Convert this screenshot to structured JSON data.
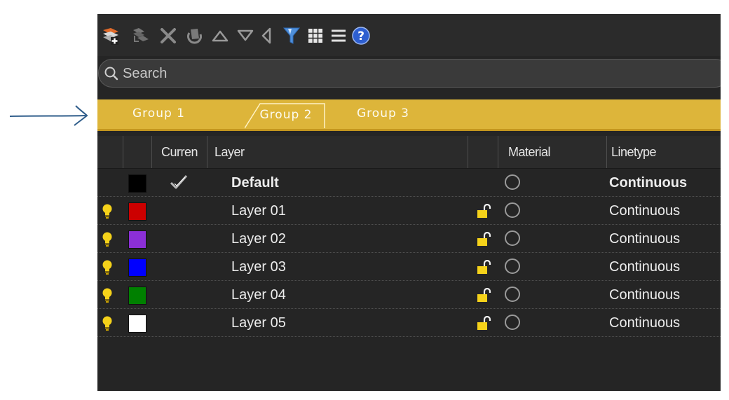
{
  "search": {
    "placeholder": "Search"
  },
  "groups": [
    {
      "label": "Group 1"
    },
    {
      "label": "Group 2"
    },
    {
      "label": "Group 3"
    }
  ],
  "columns": {
    "current": "Curren",
    "layer": "Layer",
    "material": "Material",
    "linetype": "Linetype"
  },
  "toolbar_icons": [
    "new-layer-icon",
    "new-sublayer-icon",
    "delete-icon",
    "purge-icon",
    "move-up-icon",
    "move-down-icon",
    "collapse-icon",
    "filter-icon",
    "grid-icon",
    "menu-icon",
    "help-icon"
  ],
  "colors": {
    "accent_tab_bar": "#ddb53a",
    "panel_bg": "#252525",
    "arrow": "#2e5c8a"
  },
  "layers": [
    {
      "name": "Default",
      "color": "#000000",
      "current": true,
      "bulb": false,
      "lock": false,
      "linetype": "Continuous",
      "bold": true
    },
    {
      "name": "Layer 01",
      "color": "#cc0000",
      "current": false,
      "bulb": true,
      "lock": true,
      "linetype": "Continuous",
      "bold": false
    },
    {
      "name": "Layer 02",
      "color": "#8b2fd6",
      "current": false,
      "bulb": true,
      "lock": true,
      "linetype": "Continuous",
      "bold": false
    },
    {
      "name": "Layer 03",
      "color": "#0000ff",
      "current": false,
      "bulb": true,
      "lock": true,
      "linetype": "Continuous",
      "bold": false
    },
    {
      "name": "Layer 04",
      "color": "#008000",
      "current": false,
      "bulb": true,
      "lock": true,
      "linetype": "Continuous",
      "bold": false
    },
    {
      "name": "Layer 05",
      "color": "#ffffff",
      "current": false,
      "bulb": true,
      "lock": true,
      "linetype": "Continuous",
      "bold": false
    }
  ]
}
